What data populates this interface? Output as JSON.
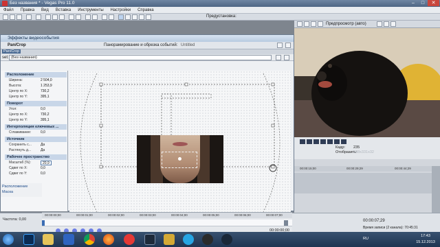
{
  "window": {
    "title": "Без названия * - Vegas Pro 11.0",
    "controls": [
      "–",
      "□",
      "✕"
    ]
  },
  "menu": [
    "Файл",
    "Правка",
    "Вид",
    "Вставка",
    "Инструменты",
    "Настройки",
    "Справка"
  ],
  "toolbar": {
    "preset_label": "Предустановка:"
  },
  "preview_bar": {
    "label": "Предпросмотр (авто)"
  },
  "preview_info": {
    "frame_label": "Кадр:",
    "frame_value": "235",
    "display_label": "Отобразить:",
    "display_value": "588x331x32"
  },
  "dialog": {
    "title": "Эффекты видеособытия",
    "tab_label": "Pan/Crop",
    "subtitle": "Панорамирование и обрезка событий:",
    "subtitle_value": "Untitled",
    "panel_label": "Pan/Crop",
    "preset_label": "set:",
    "preset_value": "(Без названия)",
    "sections": [
      {
        "name": "Расположение",
        "rows": [
          {
            "k": "Ширина:",
            "v": "2 504,0"
          },
          {
            "k": "Высота:",
            "v": "1 253,9"
          },
          {
            "k": "Центр по X:",
            "v": "730,2"
          },
          {
            "k": "Центр по Y:",
            "v": "395,1"
          }
        ]
      },
      {
        "name": "Поворот",
        "rows": [
          {
            "k": "Угол:",
            "v": "0,0"
          },
          {
            "k": "Центр по X:",
            "v": "730,2"
          },
          {
            "k": "Центр по Y:",
            "v": "395,1"
          }
        ]
      },
      {
        "name": "Интерполяция ключевых ...",
        "rows": [
          {
            "k": "Сглаживание:",
            "v": "0,0"
          }
        ]
      },
      {
        "name": "Источник",
        "rows": [
          {
            "k": "Сохранить с...",
            "v": "Да"
          },
          {
            "k": "Растянуть д...",
            "v": "Да"
          }
        ]
      },
      {
        "name": "Рабочее пространство",
        "rows": [
          {
            "k": "Масштаб (%):",
            "v": "20,9"
          },
          {
            "k": "Сдвиг по X:",
            "v": "0,0"
          },
          {
            "k": "Сдвиг по Y:",
            "v": "0,0"
          }
        ]
      }
    ],
    "left_links": [
      "Расположение",
      "Маска"
    ],
    "ruler_ticks": [
      "00:00:00;00",
      "00:00:01;00",
      "00:00:02;00",
      "00:00:03;00",
      "00:00:04;00",
      "00:00:05;00",
      "00:00:06;00",
      "00:00:07;00"
    ],
    "dialog_time": "00:00:00;00"
  },
  "timeline_right": {
    "ticks": [
      "00:00:15;00",
      "00:00:29;29",
      "00:00:44;29"
    ]
  },
  "bottom": {
    "rate_label": "Частота: 0,00",
    "time": "00:00:07;29",
    "status": "Время записи (2 канала): 70:45:31"
  },
  "taskbar": {
    "lang": "RU",
    "time": "17:43",
    "date": "15.12.2013",
    "apps": [
      "start",
      "photoshop",
      "explorer",
      "chrome",
      "firefox",
      "yandex",
      "vegas",
      "skype",
      "obs",
      "steam"
    ]
  },
  "colors": {
    "accent": "#4a6a92",
    "selection": "#5479a8",
    "title_bar": "#4d6584"
  }
}
